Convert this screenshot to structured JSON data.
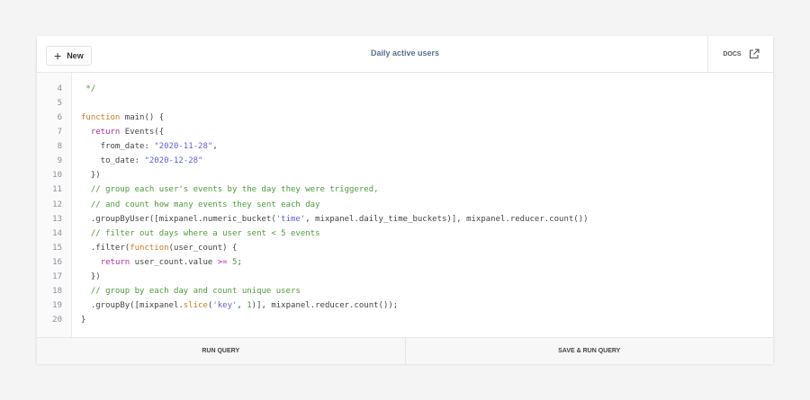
{
  "header": {
    "new_label": "New",
    "title": "Daily active users",
    "docs_label": "DOCS"
  },
  "icons": {
    "new": "plus-icon",
    "docs": "external-link-icon"
  },
  "colors": {
    "keyword": "#c77a22",
    "return": "#b1309b",
    "string": "#5c5fd6",
    "comment": "#4e9a3c",
    "title": "#5a7192"
  },
  "editor": {
    "lines": [
      {
        "n": "4",
        "tokens": [
          [
            "com",
            " */"
          ]
        ]
      },
      {
        "n": "5",
        "tokens": []
      },
      {
        "n": "6",
        "tokens": [
          [
            "kw",
            "function"
          ],
          [
            "",
            " main() {"
          ]
        ]
      },
      {
        "n": "7",
        "tokens": [
          [
            "",
            "  "
          ],
          [
            "ret",
            "return"
          ],
          [
            "",
            " Events({"
          ]
        ]
      },
      {
        "n": "8",
        "tokens": [
          [
            "",
            "    from_date: "
          ],
          [
            "str",
            "\"2020-11-28\""
          ],
          [
            "",
            ","
          ]
        ]
      },
      {
        "n": "9",
        "tokens": [
          [
            "",
            "    to_date: "
          ],
          [
            "str",
            "\"2020-12-28\""
          ]
        ]
      },
      {
        "n": "10",
        "tokens": [
          [
            "",
            "  })"
          ]
        ]
      },
      {
        "n": "11",
        "tokens": [
          [
            "",
            "  "
          ],
          [
            "com",
            "// group each user's events by the day they were triggered,"
          ]
        ]
      },
      {
        "n": "12",
        "tokens": [
          [
            "",
            "  "
          ],
          [
            "com",
            "// and count how many events they sent each day"
          ]
        ]
      },
      {
        "n": "13",
        "tokens": [
          [
            "",
            "  .groupByUser([mixpanel.numeric_bucket("
          ],
          [
            "str",
            "'time'"
          ],
          [
            "",
            ", mixpanel.daily_time_buckets)], mixpanel.reducer.count())"
          ]
        ]
      },
      {
        "n": "14",
        "tokens": [
          [
            "",
            "  "
          ],
          [
            "com",
            "// filter out days where a user sent < 5 events"
          ]
        ]
      },
      {
        "n": "15",
        "tokens": [
          [
            "",
            "  .filter("
          ],
          [
            "kw",
            "function"
          ],
          [
            "",
            "(user_count) {"
          ]
        ]
      },
      {
        "n": "16",
        "tokens": [
          [
            "",
            "    "
          ],
          [
            "ret",
            "return"
          ],
          [
            "",
            " user_count.value "
          ],
          [
            "op",
            ">="
          ],
          [
            "",
            " "
          ],
          [
            "num",
            "5"
          ],
          [
            "",
            ";"
          ]
        ]
      },
      {
        "n": "17",
        "tokens": [
          [
            "",
            "  })"
          ]
        ]
      },
      {
        "n": "18",
        "tokens": [
          [
            "",
            "  "
          ],
          [
            "com",
            "// group by each day and count unique users"
          ]
        ]
      },
      {
        "n": "19",
        "tokens": [
          [
            "",
            "  .groupBy([mixpanel."
          ],
          [
            "kw",
            "slice"
          ],
          [
            "",
            "("
          ],
          [
            "str",
            "'key'"
          ],
          [
            "",
            ", "
          ],
          [
            "num",
            "1"
          ],
          [
            "",
            ")], mixpanel.reducer.count());"
          ]
        ]
      },
      {
        "n": "20",
        "tokens": [
          [
            "",
            "}"
          ]
        ]
      }
    ]
  },
  "footer": {
    "run_label": "RUN QUERY",
    "save_run_label": "SAVE & RUN QUERY"
  }
}
